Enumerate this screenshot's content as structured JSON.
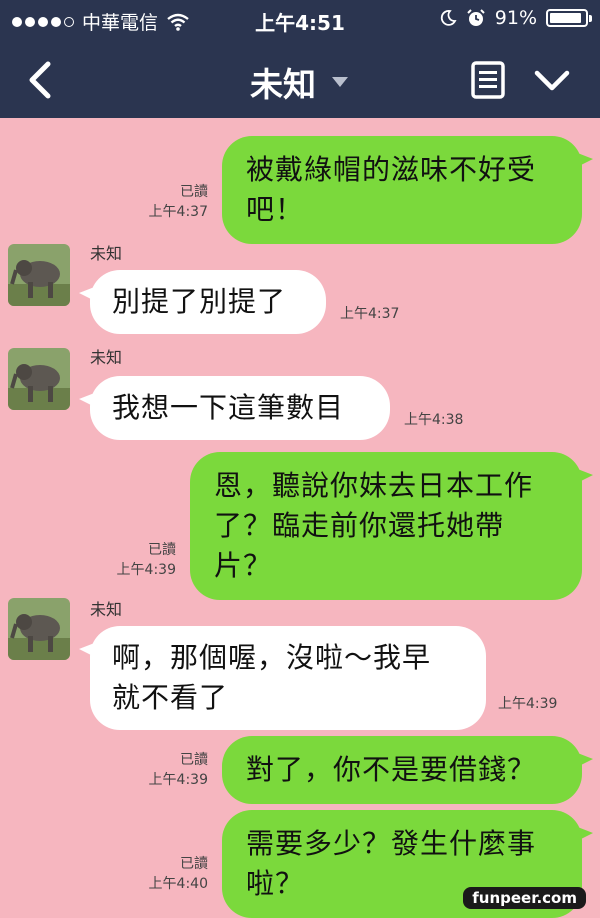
{
  "status_bar": {
    "carrier": "中華電信",
    "time": "上午4:51",
    "battery": "91%",
    "battery_level": 0.91,
    "icons": [
      "signal-dots",
      "wifi-icon",
      "moon-icon",
      "alarm-icon",
      "battery-icon"
    ]
  },
  "nav": {
    "title": "未知",
    "icons": [
      "back-chevron-icon",
      "dropdown-caret-icon",
      "menu-list-icon",
      "chevron-down-icon"
    ]
  },
  "colors": {
    "bar": "#2b3550",
    "chat_background": "#f6b6bf",
    "outgoing_bubble": "#7bd93c",
    "incoming_bubble": "#ffffff"
  },
  "messages": [
    {
      "dir": "out",
      "lines": [
        "被戴綠帽的滋味不好受",
        "吧！"
      ],
      "read": "已讀",
      "time": "上午4:37"
    },
    {
      "dir": "in",
      "sender": "未知",
      "lines": [
        "別提了別提了"
      ],
      "time": "上午4:37"
    },
    {
      "dir": "in",
      "sender": "未知",
      "lines": [
        "我想一下這筆數目"
      ],
      "time": "上午4:38"
    },
    {
      "dir": "out",
      "lines": [
        "恩，聽說你妹去日本工作",
        "了？臨走前你還托她帶",
        "片？"
      ],
      "read": "已讀",
      "time": "上午4:39"
    },
    {
      "dir": "in",
      "sender": "未知",
      "lines": [
        "啊，那個喔，沒啦～我早",
        "就不看了"
      ],
      "time": "上午4:39"
    },
    {
      "dir": "out",
      "lines": [
        "對了，你不是要借錢？"
      ],
      "read": "已讀",
      "time": "上午4:39"
    },
    {
      "dir": "out",
      "lines": [
        "需要多少？發生什麼事",
        "啦？"
      ],
      "read": "已讀",
      "time": "上午4:40"
    }
  ],
  "watermark": "funpeer.com"
}
